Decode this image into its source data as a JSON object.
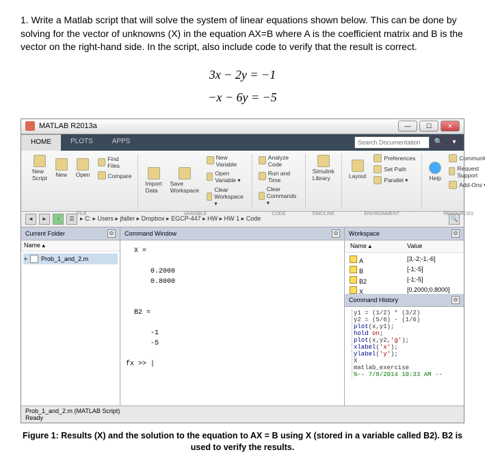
{
  "document": {
    "question_number": "1.",
    "question_text": "Write a Matlab script that will solve the system of linear equations shown below. This can be done by solving for the vector of unknowns (X) in the equation AX=B where A is the coefficient matrix and B is the vector on the right-hand side. In the script, also include code to verify that the result is correct.",
    "eq1": "3x − 2y = −1",
    "eq2": "−x − 6y = −5",
    "caption": "Figure 1: Results (X) and the solution to the equation to AX = B using X (stored in a variable called B2). B2 is used to verify the results."
  },
  "window": {
    "title": "MATLAB R2013a",
    "tabs": {
      "home": "HOME",
      "plots": "PLOTS",
      "apps": "APPS"
    },
    "search_placeholder": "Search Documentation"
  },
  "toolstrip": {
    "file": {
      "new": "New",
      "new_script": "New Script",
      "open": "Open",
      "find_files": "Find Files",
      "compare": "Compare",
      "label": "FILE"
    },
    "variable": {
      "import": "Import Data",
      "save": "Save Workspace",
      "new_var": "New Variable",
      "open_var": "Open Variable ▾",
      "clear": "Clear Workspace ▾",
      "label": "VARIABLE"
    },
    "code": {
      "analyze": "Analyze Code",
      "run_time": "Run and Time",
      "clear_cmd": "Clear Commands ▾",
      "label": "CODE"
    },
    "simulink": {
      "lib": "Simulink Library",
      "label": "SIMULINK"
    },
    "environment": {
      "layout": "Layout",
      "prefs": "Preferences",
      "set_path": "Set Path",
      "parallel": "Parallel ▾",
      "label": "ENVIRONMENT"
    },
    "resources": {
      "help": "Help",
      "community": "Community",
      "support": "Request Support",
      "addons": "Add-Ons ▾",
      "label": "RESOURCES"
    }
  },
  "address": {
    "path": "▸ C: ▸ Users ▸ jfaller ▸ Dropbox ▸ EGCP-447 ▸ HW ▸ HW 1 ▸ Code"
  },
  "panels": {
    "current_folder": {
      "title": "Current Folder",
      "col_name": "Name ▴",
      "file1": "Prob_1_and_2.m"
    },
    "command_window": {
      "title": "Command Window",
      "output": "  X =\n\n      0.2000\n      0.8000\n\n\n  B2 =\n\n      -1\n      -5\n\nfx >> |"
    },
    "workspace": {
      "title": "Workspace",
      "col_name": "Name ▴",
      "col_value": "Value",
      "rows": [
        {
          "name": "A",
          "value": "[3,-2;-1,-6]"
        },
        {
          "name": "B",
          "value": "[-1;-5]"
        },
        {
          "name": "B2",
          "value": "[-1;-5]"
        },
        {
          "name": "X",
          "value": "[0.2000;0.8000]"
        }
      ]
    },
    "command_history": {
      "title": "Command History",
      "lines": [
        "y1 = (1/2) * (3/2)",
        "y2 = (5/6) - (1/6)",
        "plot(x,y1);",
        "hold on;",
        "plot(x,y2,'g');",
        "xlabel('x');",
        "ylabel('y');",
        "X",
        "matlab_exercise",
        "%-- 7/8/2014 10:33 AM --"
      ]
    }
  },
  "statusbar": {
    "script": "Prob_1_and_2.m (MATLAB Script)",
    "ready": "Ready"
  }
}
